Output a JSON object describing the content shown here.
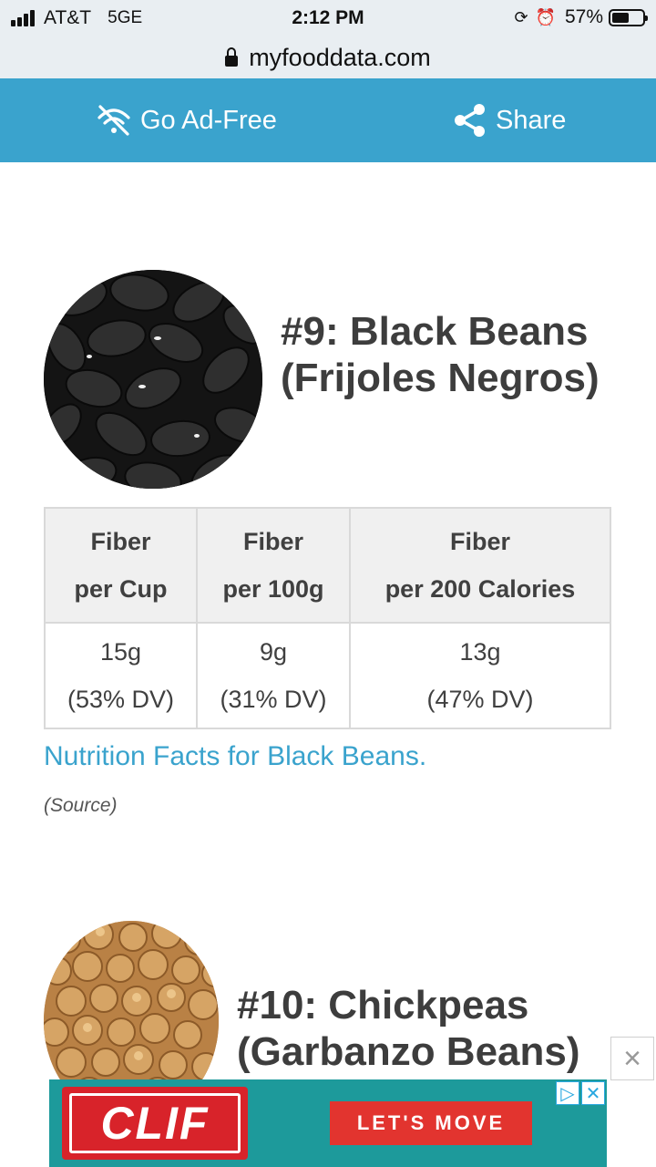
{
  "status_bar": {
    "carrier": "AT&T",
    "network": "5GE",
    "time": "2:12 PM",
    "battery_percent": "57%",
    "battery_level": 0.57
  },
  "browser": {
    "url": "myfooddata.com"
  },
  "action_bar": {
    "ad_free_label": "Go Ad-Free",
    "share_label": "Share",
    "background_color": "#3aa3cd"
  },
  "item9": {
    "title": "#9: Black Beans (Frijoles Negros)",
    "image_icon": "black-beans-photo",
    "table": {
      "headers": [
        {
          "line1": "Fiber",
          "line2": "per Cup"
        },
        {
          "line1": "Fiber",
          "line2": "per 100g"
        },
        {
          "line1": "Fiber",
          "line2": "per 200 Calories"
        }
      ],
      "values": [
        {
          "amount": "15g",
          "dv": "(53% DV)"
        },
        {
          "amount": "9g",
          "dv": "(31% DV)"
        },
        {
          "amount": "13g",
          "dv": "(47% DV)"
        }
      ]
    },
    "nutrition_link": "Nutrition Facts for Black Beans.",
    "source_note": "(Source)"
  },
  "item10": {
    "title": "#10: Chickpeas (Garbanzo Beans)",
    "image_icon": "chickpeas-photo"
  },
  "ad": {
    "close_label": "×",
    "brand": "CLIF",
    "cta": "LET'S MOVE",
    "adchoices_icon": "▷",
    "adchoices_close": "✕",
    "background_color": "#1d9a9b"
  }
}
